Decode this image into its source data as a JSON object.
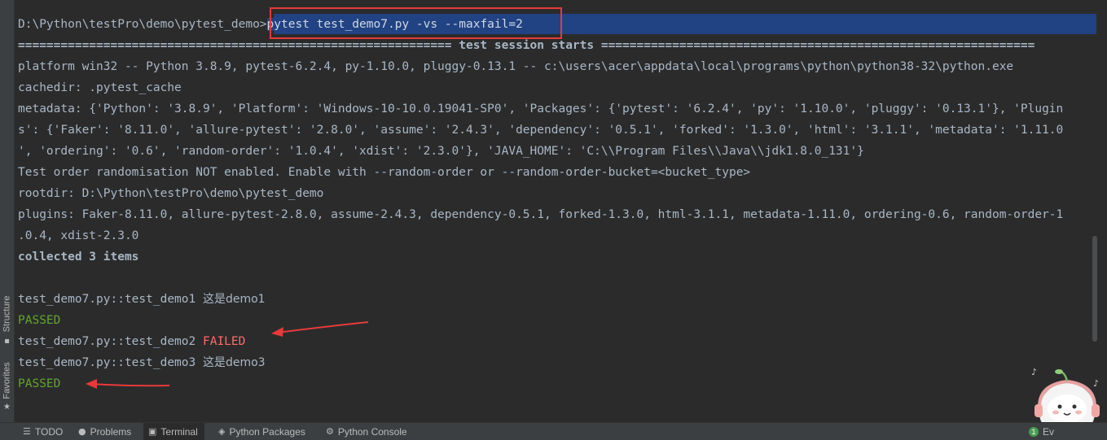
{
  "terminal": {
    "prompt": "D:\\Python\\testPro\\demo\\pytest_demo>",
    "command": "pytest test_demo7.py -vs --maxfail=2",
    "session_line": "============================================================= test session starts =============================================================",
    "platform_line": "platform win32 -- Python 3.8.9, pytest-6.2.4, py-1.10.0, pluggy-0.13.1 -- c:\\users\\acer\\appdata\\local\\programs\\python\\python38-32\\python.exe",
    "cachedir_line": "cachedir: .pytest_cache",
    "metadata_line1": "metadata: {'Python': '3.8.9', 'Platform': 'Windows-10-10.0.19041-SP0', 'Packages': {'pytest': '6.2.4', 'py': '1.10.0', 'pluggy': '0.13.1'}, 'Plugin",
    "metadata_line2": "s': {'Faker': '8.11.0', 'allure-pytest': '2.8.0', 'assume': '2.4.3', 'dependency': '0.5.1', 'forked': '1.3.0', 'html': '3.1.1', 'metadata': '1.11.0",
    "metadata_line3": "', 'ordering': '0.6', 'random-order': '1.0.4', 'xdist': '2.3.0'}, 'JAVA_HOME': 'C:\\\\Program Files\\\\Java\\\\jdk1.8.0_131'}",
    "random_order_line": "Test order randomisation NOT enabled. Enable with --random-order or --random-order-bucket=<bucket_type>",
    "rootdir_line": "rootdir: D:\\Python\\testPro\\demo\\pytest_demo",
    "plugins_line1": "plugins: Faker-8.11.0, allure-pytest-2.8.0, assume-2.4.3, dependency-0.5.1, forked-1.3.0, html-3.1.1, metadata-1.11.0, ordering-0.6, random-order-1",
    "plugins_line2": ".0.4, xdist-2.3.0",
    "collected_line": "collected 3 items",
    "test1_name": "test_demo7.py::test_demo1 ",
    "test1_output": "这是demo1",
    "test1_result": "PASSED",
    "test2_name": "test_demo7.py::test_demo2 ",
    "test2_result": "FAILED",
    "test3_name": "test_demo7.py::test_demo3 ",
    "test3_output": "这是demo3",
    "test3_result": "PASSED"
  },
  "left_strip": {
    "structure_label": "Structure",
    "favorites_label": "Favorites"
  },
  "bottom_tabs": [
    {
      "label": "TODO",
      "icon": "list-icon"
    },
    {
      "label": "Problems",
      "icon": "problems-icon"
    },
    {
      "label": "Terminal",
      "icon": "terminal-icon"
    },
    {
      "label": "Python Packages",
      "icon": "packages-icon"
    },
    {
      "label": "Python Console",
      "icon": "console-icon"
    }
  ],
  "event_log": {
    "count": "1",
    "label": "Ev"
  },
  "colors": {
    "background": "#2b2b2b",
    "text": "#a9b7c6",
    "passed": "#62a531",
    "failed": "#ff6b68",
    "selection": "#214283",
    "annotation": "#e83a3a"
  }
}
